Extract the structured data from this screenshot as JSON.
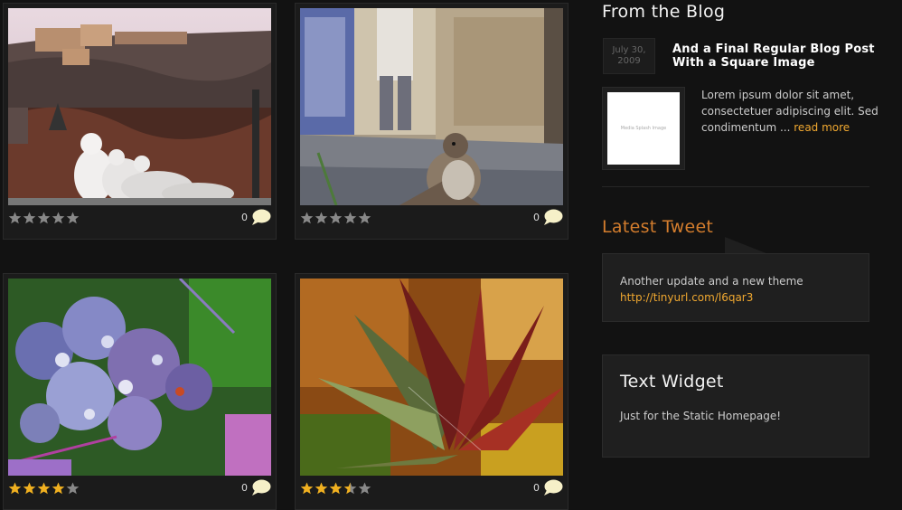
{
  "gallery": [
    {
      "comments": "0",
      "rating": 0,
      "photo": "hillside-seagulls"
    },
    {
      "comments": "0",
      "rating": 0,
      "photo": "sparrow-pavement"
    },
    {
      "comments": "0",
      "rating": 4,
      "photo": "hydrangea-dew"
    },
    {
      "comments": "0",
      "rating": 3.5,
      "photo": "succulent-closeup"
    }
  ],
  "sidebar": {
    "blog": {
      "title": "From the Blog",
      "date_line1": "July 30,",
      "date_line2": "2009",
      "post_title": "And a Final Regular Blog Post With a Square Image",
      "thumb_label": "Media Splash Image",
      "excerpt": "Lorem ipsum dolor sit amet, consectetuer adipiscing elit. Sed condimentum ...",
      "read_more": "read more"
    },
    "tweet": {
      "title": "Latest Tweet",
      "text": "Another update and a new theme",
      "link": "http://tinyurl.com/l6qar3"
    },
    "text_widget": {
      "title": "Text Widget",
      "body": "Just for the Static Homepage!"
    }
  },
  "colors": {
    "accent": "#f0a830",
    "heading_orange": "#d47d2d",
    "star_on": "#f0b020",
    "star_off": "#888888"
  }
}
